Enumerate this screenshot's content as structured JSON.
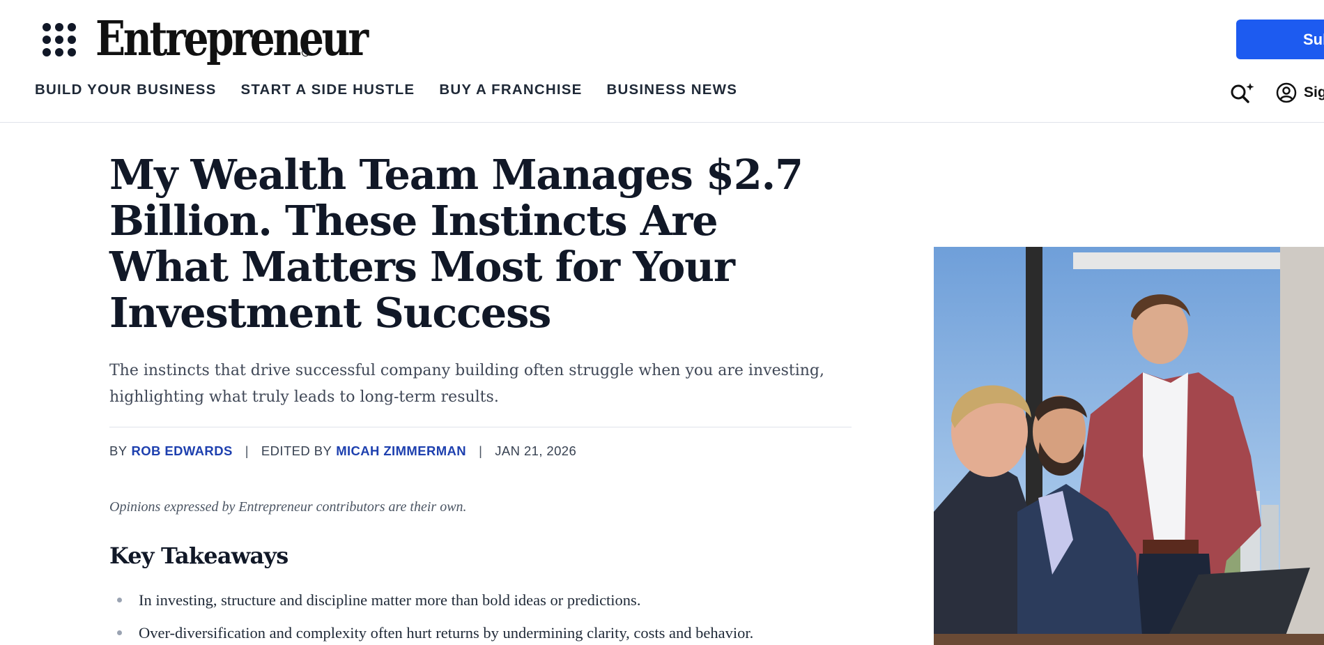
{
  "header": {
    "logo_text": "Entrepreneur",
    "subscribe_label": "Subscribe",
    "signin_label": "Sign In",
    "nav": [
      {
        "label": "BUILD YOUR BUSINESS"
      },
      {
        "label": "START A SIDE HUSTLE"
      },
      {
        "label": "BUY A FRANCHISE"
      },
      {
        "label": "BUSINESS NEWS"
      }
    ]
  },
  "article": {
    "headline": "My Wealth Team Manages $2.7 Billion. These Instincts Are What Matters Most for Your Investment Success",
    "dek": "The instincts that drive successful company building often struggle when you are investing, highlighting what truly leads to long-term results.",
    "byline": {
      "by_prefix": "BY",
      "author": "ROB EDWARDS",
      "separator": "|",
      "edited_prefix": "EDITED BY",
      "editor": "MICAH ZIMMERMAN",
      "date": "JAN 21, 2026"
    },
    "disclaimer": "Opinions expressed by Entrepreneur contributors are their own.",
    "key_takeaways": {
      "title": "Key Takeaways",
      "items": [
        "In investing, structure and discipline matter more than bold ideas or predictions.",
        "Over-diversification and complexity often hurt returns by undermining clarity, costs and behavior."
      ]
    }
  },
  "colors": {
    "accent": "#1d5bf0",
    "link": "#1e40af",
    "heading": "#111827"
  },
  "icons": {
    "menu": "grid-dots-icon",
    "search": "search-sparkle-icon",
    "user": "user-circle-icon"
  }
}
